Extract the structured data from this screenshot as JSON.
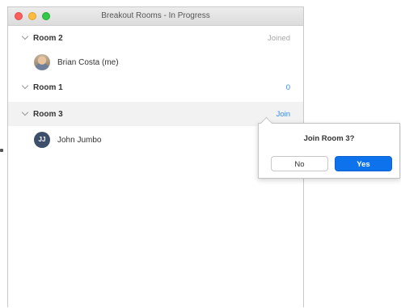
{
  "window": {
    "title": "Breakout Rooms - In Progress"
  },
  "rooms": [
    {
      "name": "Room 2",
      "status": "Joined",
      "members": [
        {
          "name": "Brian Costa (me)",
          "avatar": "photo"
        }
      ]
    },
    {
      "name": "Room 1",
      "status": "0",
      "members": []
    },
    {
      "name": "Room 3",
      "status": "Join",
      "members": [
        {
          "name": "John Jumbo",
          "avatar": "initials",
          "initials": "JJ"
        }
      ]
    }
  ],
  "popover": {
    "title": "Join Room 3?",
    "no_label": "No",
    "yes_label": "Yes"
  },
  "colors": {
    "accent": "#0e72ed",
    "link": "#2d8cff",
    "muted": "#a9a9a9",
    "avatar_initials_bg": "#3d4f6b"
  }
}
